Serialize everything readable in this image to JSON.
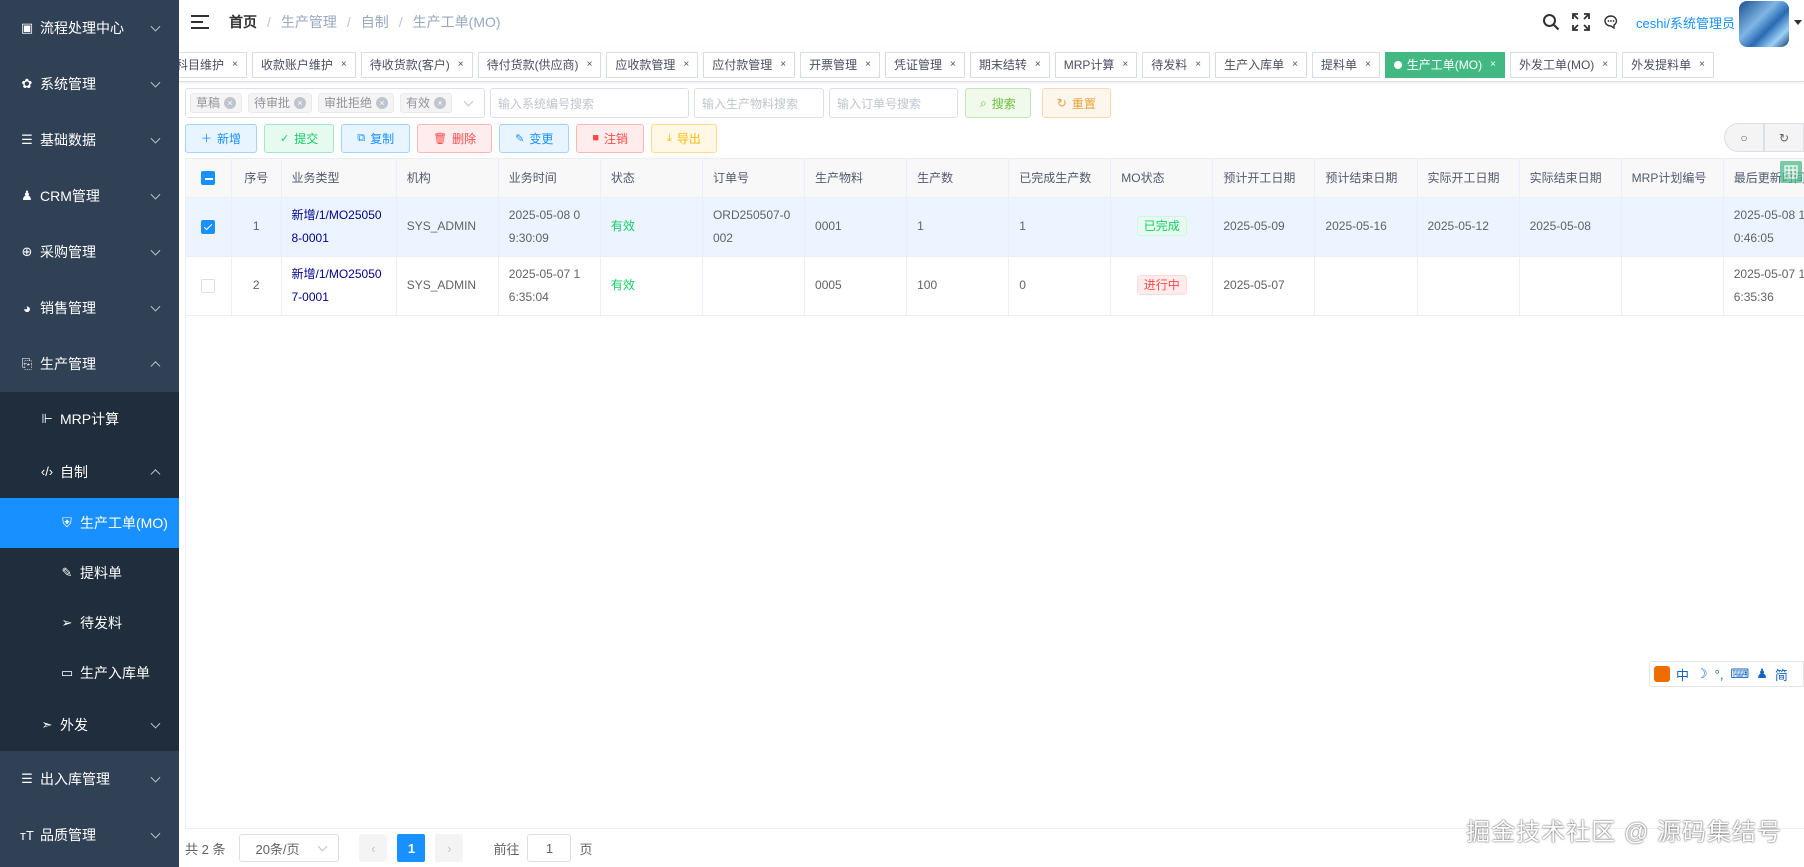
{
  "sidebar": {
    "items": [
      {
        "label": "流程处理中心",
        "icon": "chat-icon"
      },
      {
        "label": "系统管理",
        "icon": "gear-icon"
      },
      {
        "label": "基础数据",
        "icon": "database-icon"
      },
      {
        "label": "CRM管理",
        "icon": "user-icon"
      },
      {
        "label": "采购管理",
        "icon": "globe-icon"
      },
      {
        "label": "销售管理",
        "icon": "earth-icon"
      }
    ],
    "production": {
      "label": "生产管理",
      "icon": "box-icon"
    },
    "mrp": {
      "label": "MRP计算",
      "icon": "tree-icon"
    },
    "self_made": {
      "label": "自制",
      "icon": "code-icon"
    },
    "self_items": [
      {
        "label": "生产工单(MO)",
        "icon": "shield-icon"
      },
      {
        "label": "提料单",
        "icon": "edit-icon"
      },
      {
        "label": "待发料",
        "icon": "send-icon"
      },
      {
        "label": "生产入库单",
        "icon": "monitor-icon"
      }
    ],
    "outsource": {
      "label": "外发",
      "icon": "paper-plane-icon"
    },
    "bottom_items": [
      {
        "label": "出入库管理",
        "icon": "database-icon"
      },
      {
        "label": "品质管理",
        "icon": "text-icon"
      }
    ]
  },
  "header": {
    "breadcrumb": [
      "首页",
      "生产管理",
      "自制",
      "生产工单(MO)"
    ],
    "username": "ceshi/系统管理员"
  },
  "tags": [
    "科目维护",
    "收款账户维护",
    "待收货款(客户)",
    "待付货款(供应商)",
    "应收款管理",
    "应付款管理",
    "开票管理",
    "凭证管理",
    "期末结转",
    "MRP计算",
    "待发料",
    "生产入库单",
    "提料单",
    "生产工单(MO)",
    "外发工单(MO)",
    "外发提料单"
  ],
  "filters": {
    "status_chips": [
      "草稿",
      "待审批",
      "审批拒绝",
      "有效"
    ],
    "system_no_placeholder": "输入系统编号搜索",
    "material_placeholder": "输入生产物料搜索",
    "order_placeholder": "输入订单号搜索",
    "search_label": "搜索",
    "reset_label": "重置"
  },
  "toolbar": {
    "add": "新增",
    "submit": "提交",
    "copy": "复制",
    "delete": "删除",
    "change": "变更",
    "cancel": "注销",
    "export": "导出"
  },
  "table": {
    "columns": [
      "序号",
      "业务类型",
      "机构",
      "业务时间",
      "状态",
      "订单号",
      "生产物料",
      "生产数",
      "已完成生产数",
      "MO状态",
      "预计开工日期",
      "预计结束日期",
      "实际开工日期",
      "实际结束日期",
      "MRP计划编号",
      "最后更新时间"
    ],
    "rows": [
      {
        "index": "1",
        "type": "新增/1/MO250508-0001",
        "org": "SYS_ADMIN",
        "time": "2025-05-08 09:30:09",
        "status": "有效",
        "order_no": "ORD250507-0002",
        "material": "0001",
        "qty": "1",
        "done_qty": "1",
        "mo_status": "已完成",
        "plan_start": "2025-05-09",
        "plan_end": "2025-05-16",
        "actual_start": "2025-05-12",
        "actual_end": "2025-05-08",
        "mrp_no": "",
        "updated": "2025-05-08 10:46:05"
      },
      {
        "index": "2",
        "type": "新增/1/MO250507-0001",
        "org": "SYS_ADMIN",
        "time": "2025-05-07 16:35:04",
        "status": "有效",
        "order_no": "",
        "material": "0005",
        "qty": "100",
        "done_qty": "0",
        "mo_status": "进行中",
        "plan_start": "2025-05-07",
        "plan_end": "",
        "actual_start": "",
        "actual_end": "",
        "mrp_no": "",
        "updated": "2025-05-07 16:35:36"
      }
    ]
  },
  "pagination": {
    "total": "共 2 条",
    "page_size": "20条/页",
    "current": "1",
    "goto_prefix": "前往",
    "goto_value": "1",
    "goto_suffix": "页"
  },
  "ime": {
    "items": [
      "中",
      "☽",
      "°,",
      "⌨",
      "♟",
      "简"
    ]
  },
  "watermark": "掘金技术社区 @ 源码集结号"
}
